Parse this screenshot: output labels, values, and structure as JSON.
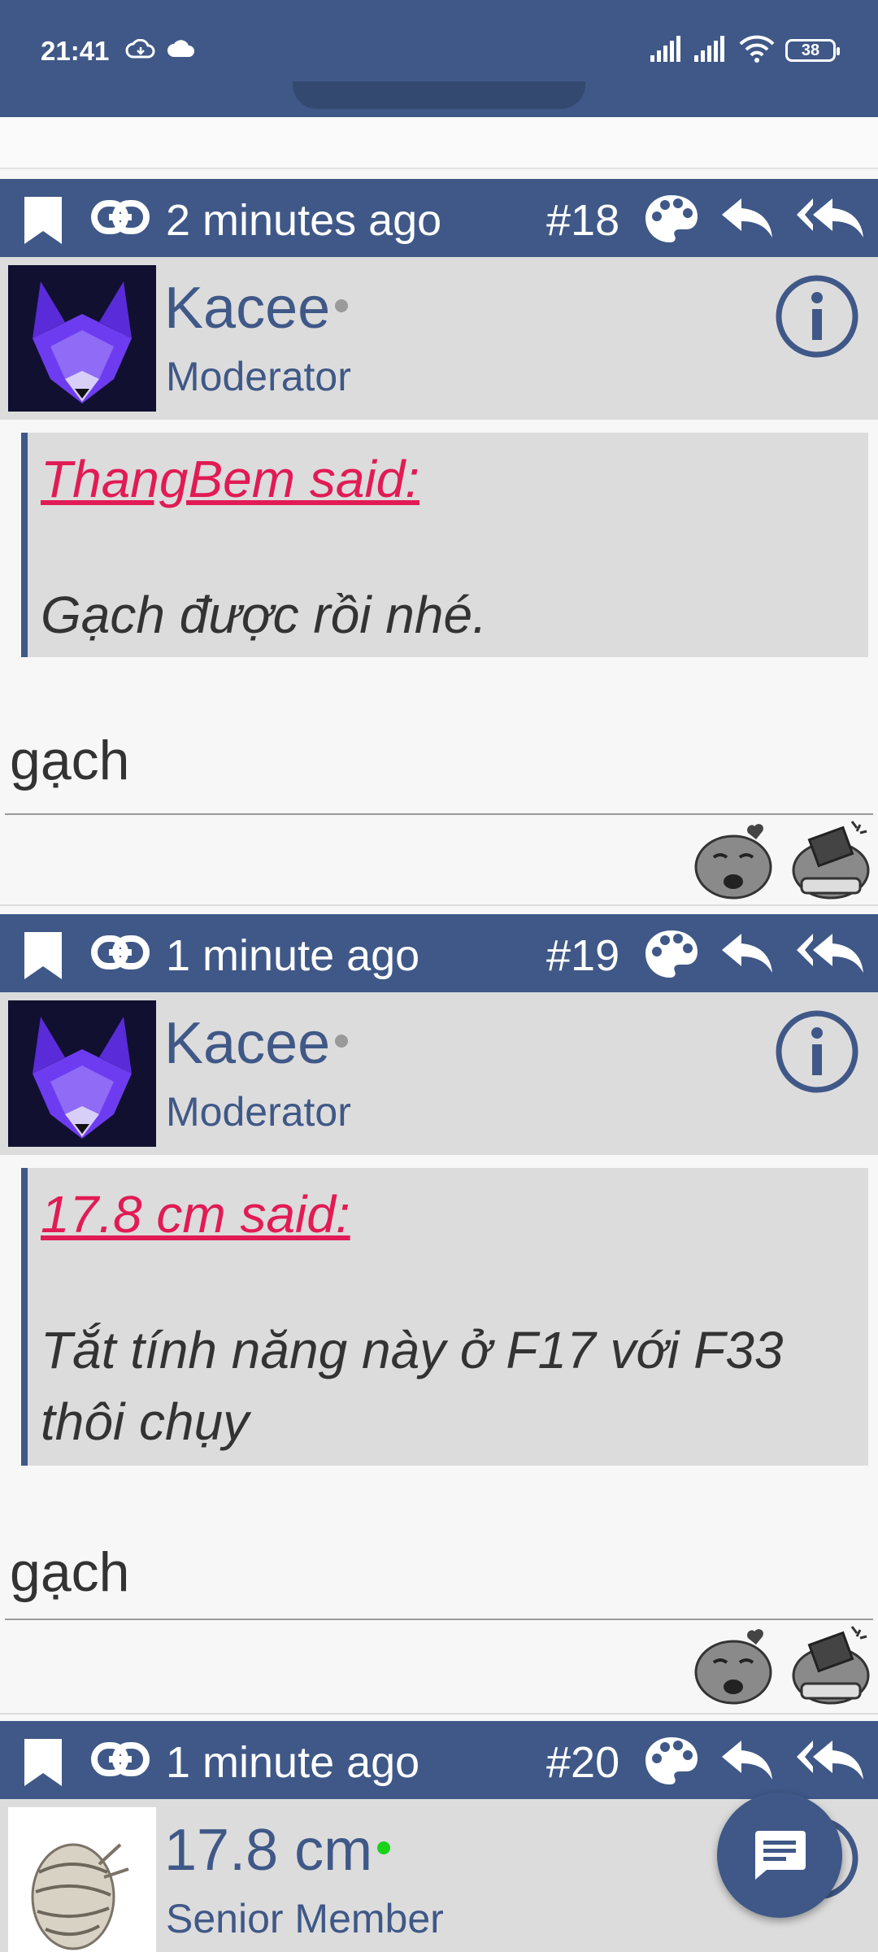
{
  "status_bar": {
    "time": "21:41",
    "battery": "38"
  },
  "posts": [
    {
      "time_ago": "2 minutes ago",
      "number": "#18",
      "username": "Kacee",
      "role": "Moderator",
      "online": false,
      "quote_author": "ThangBem said:",
      "quote_text": "Gạch được rồi nhé.",
      "content": "gạch"
    },
    {
      "time_ago": "1 minute ago",
      "number": "#19",
      "username": "Kacee",
      "role": "Moderator",
      "online": false,
      "quote_author": "17.8 cm said:",
      "quote_text": "Tắt tính năng này ở F17 với F33 thôi chụy",
      "content": "gạch"
    },
    {
      "time_ago": "1 minute ago",
      "number": "#20",
      "username": "17.8 cm",
      "role": "Senior Member",
      "online": true
    }
  ],
  "colors": {
    "header": "#3f5887",
    "quote_author": "#e11b55",
    "online_dot": "#18d318"
  },
  "icons": [
    "bookmark-icon",
    "link-icon",
    "palette-icon",
    "reply-icon",
    "reply-all-icon",
    "info-icon",
    "chat-icon"
  ]
}
